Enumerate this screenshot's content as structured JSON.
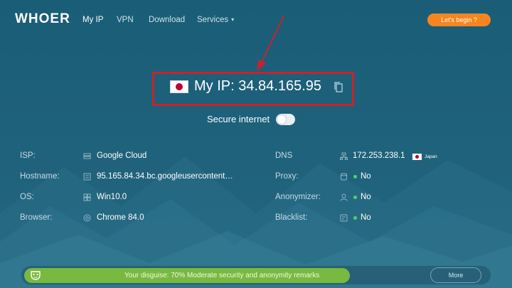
{
  "nav": {
    "logo": "WHOER",
    "links": [
      "My IP",
      "VPN",
      "Download",
      "Services"
    ],
    "cta_label": "Let's begin ?"
  },
  "ip": {
    "flag": "japan-flag",
    "text": "My IP: 34.84.165.95"
  },
  "secure": {
    "label": "Secure internet",
    "enabled": false
  },
  "left_info": [
    {
      "label": "ISP:",
      "value": "Google Cloud",
      "icon": "server-icon"
    },
    {
      "label": "Hostname:",
      "value": "95.165.84.34.bc.googleusercontent…",
      "icon": "host-icon"
    },
    {
      "label": "OS:",
      "value": "Win10.0",
      "icon": "windows-icon"
    },
    {
      "label": "Browser:",
      "value": "Chrome 84.0",
      "icon": "browser-icon"
    }
  ],
  "right_info": [
    {
      "label": "DNS",
      "value": "172.253.238.1",
      "icon": "dns-icon",
      "flag_label": "Japan"
    },
    {
      "label": "Proxy:",
      "value": "No",
      "icon": "proxy-icon"
    },
    {
      "label": "Anonymizer:",
      "value": "No",
      "icon": "anonymizer-icon"
    },
    {
      "label": "Blacklist:",
      "value": "No",
      "icon": "blacklist-icon"
    }
  ],
  "disguise": {
    "text": "Your disguise: 70% Moderate security and anonymity remarks",
    "percent": 70,
    "more_label": "More"
  },
  "colors": {
    "background": "#1f6179",
    "accent_orange": "#f7851f",
    "highlight_red": "#c8232c",
    "progress_green": "#78b93f",
    "status_green": "#4fd26c"
  }
}
